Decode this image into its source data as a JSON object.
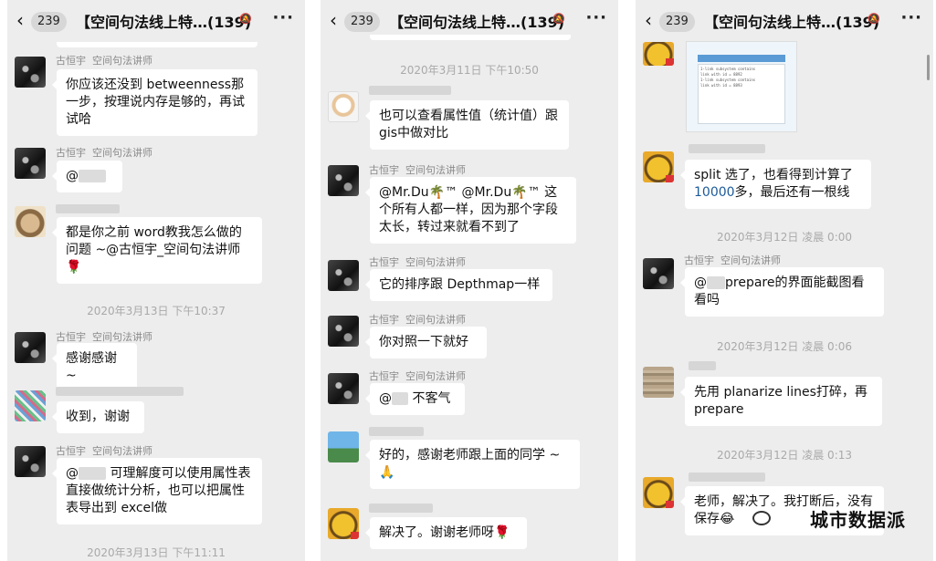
{
  "chat": {
    "unread": "239",
    "title": "【空间句法线上特…",
    "count": "(139)"
  },
  "panel1": {
    "m1": {
      "sender": "古恒宇",
      "role": "空间句法讲师",
      "text": "你应该还没到 betweenness那一步，按理说内存是够的，再试试哈"
    },
    "m2": {
      "sender": "古恒宇",
      "role": "空间句法讲师",
      "at": "@"
    },
    "m3": {
      "text": "都是你之前 word教我怎么做的问题 ~@古恒宇_空间句法讲师",
      "emoji": "🌹"
    },
    "ts1": "2020年3月13日 下午10:37",
    "m4": {
      "sender": "古恒宇",
      "role": "空间句法讲师",
      "text": "感谢感谢 ~"
    },
    "m5": {
      "text": "收到，谢谢"
    },
    "m6": {
      "sender": "古恒宇",
      "role": "空间句法讲师",
      "at": "@",
      "text": "可理解度可以使用属性表直接做统计分析，也可以把属性表导出到 excel做"
    },
    "ts2": "2020年3月13日 下午11:11"
  },
  "panel2": {
    "ts1": "2020年3月11日 下午10:50",
    "m1": {
      "text": "也可以查看属性值（统计值）跟 gis中做对比"
    },
    "m2": {
      "sender": "古恒宇",
      "role": "空间句法讲师",
      "text": "@Mr.Du🌴™ @Mr.Du🌴™ 这个所有人都一样，因为那个字段太长，转过来就看不到了"
    },
    "m3": {
      "sender": "古恒宇",
      "role": "空间句法讲师",
      "text": "它的排序跟 Depthmap一样"
    },
    "m4": {
      "sender": "古恒宇",
      "role": "空间句法讲师",
      "text": "你对照一下就好"
    },
    "m5": {
      "sender": "古恒宇",
      "role": "空间句法讲师",
      "at": "@",
      "text": "不客气"
    },
    "m6": {
      "text": "好的，感谢老师跟上面的同学 ~",
      "emoji": "🙏"
    },
    "m7": {
      "text": "解决了。谢谢老师呀",
      "emoji": "🌹"
    }
  },
  "panel3": {
    "m1": {
      "text_a": "split 选了，也看得到计算了",
      "num": "10000",
      "text_b": "多，最后还有一根线"
    },
    "ts1": "2020年3月12日 凌晨 0:00",
    "m2": {
      "sender": "古恒宇",
      "role": "空间句法讲师",
      "at": "@",
      "text": "prepare的界面能截图看看吗"
    },
    "ts2": "2020年3月12日 凌晨 0:06",
    "m3": {
      "text": "先用 planarize lines打碎，再 prepare"
    },
    "ts3": "2020年3月12日 凌晨 0:13",
    "m4": {
      "text": "老师，解决了。我打断后，没有保存",
      "emoji": "😂"
    },
    "screenshot_lines": [
      "1-link subsystem contains",
      "link with id = 8892",
      "1-link subsystem contains",
      "link with id = 8893"
    ],
    "watermark": "城市数据派"
  }
}
